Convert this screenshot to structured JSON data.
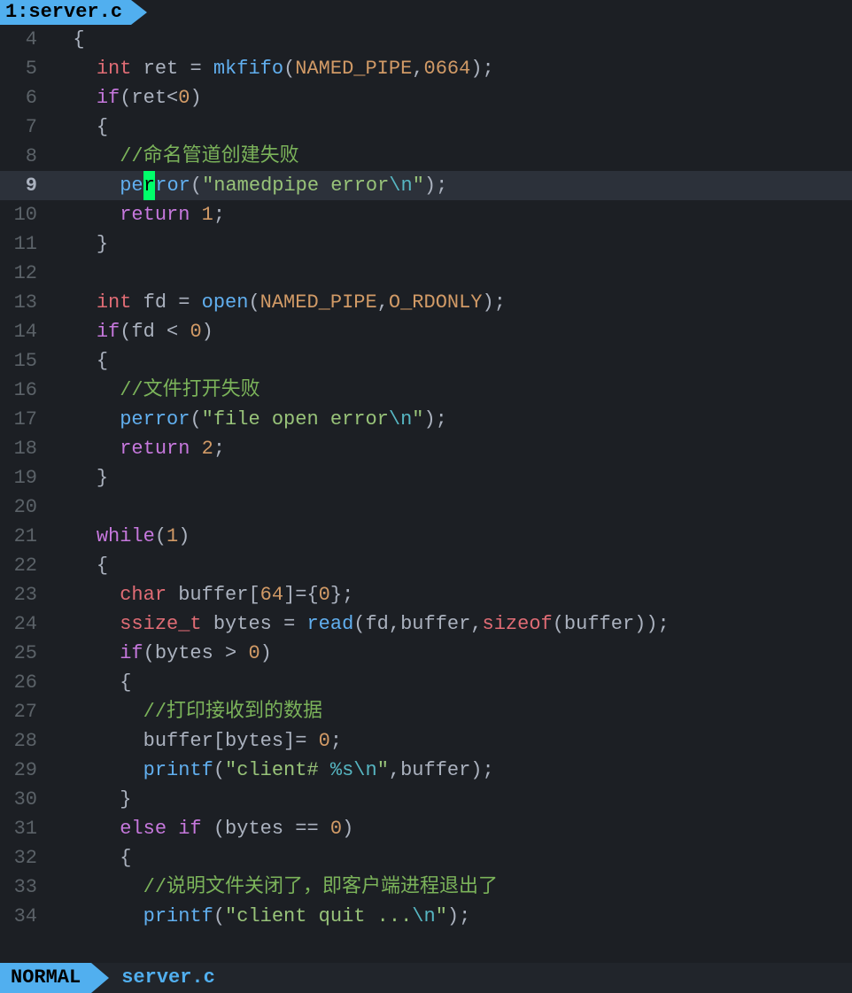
{
  "tab": {
    "index": "1",
    "filename": "server.c"
  },
  "status": {
    "mode": "NORMAL",
    "filename": "server.c"
  },
  "cursor": {
    "line": 9,
    "char": "r"
  },
  "lines": [
    {
      "num": 4,
      "indent": 1,
      "tokens": [
        {
          "cls": "brace",
          "t": "{"
        }
      ]
    },
    {
      "num": 5,
      "indent": 2,
      "tokens": [
        {
          "cls": "kw-type",
          "t": "int"
        },
        {
          "cls": "punct",
          "t": " ret "
        },
        {
          "cls": "op",
          "t": "="
        },
        {
          "cls": "punct",
          "t": " "
        },
        {
          "cls": "fn",
          "t": "mkfifo"
        },
        {
          "cls": "punct",
          "t": "("
        },
        {
          "cls": "const",
          "t": "NAMED_PIPE"
        },
        {
          "cls": "punct",
          "t": ","
        },
        {
          "cls": "num",
          "t": "0664"
        },
        {
          "cls": "punct",
          "t": ");"
        }
      ]
    },
    {
      "num": 6,
      "indent": 2,
      "tokens": [
        {
          "cls": "kw-ctrl",
          "t": "if"
        },
        {
          "cls": "punct",
          "t": "(ret"
        },
        {
          "cls": "op",
          "t": "<"
        },
        {
          "cls": "num",
          "t": "0"
        },
        {
          "cls": "punct",
          "t": ")"
        }
      ]
    },
    {
      "num": 7,
      "indent": 2,
      "tokens": [
        {
          "cls": "brace",
          "t": "{"
        }
      ]
    },
    {
      "num": 8,
      "indent": 3,
      "tokens": [
        {
          "cls": "comment",
          "t": "//命名管道创建失败"
        }
      ]
    },
    {
      "num": 9,
      "indent": 3,
      "current": true,
      "tokens": [
        {
          "cls": "fn",
          "t": "pe"
        },
        {
          "cls": "cursor",
          "t": "r"
        },
        {
          "cls": "fn",
          "t": "ror"
        },
        {
          "cls": "punct",
          "t": "("
        },
        {
          "cls": "str",
          "t": "\"namedpipe error"
        },
        {
          "cls": "esc",
          "t": "\\n"
        },
        {
          "cls": "str",
          "t": "\""
        },
        {
          "cls": "punct",
          "t": ");"
        }
      ]
    },
    {
      "num": 10,
      "indent": 3,
      "tokens": [
        {
          "cls": "kw-ctrl",
          "t": "return"
        },
        {
          "cls": "punct",
          "t": " "
        },
        {
          "cls": "num",
          "t": "1"
        },
        {
          "cls": "punct",
          "t": ";"
        }
      ]
    },
    {
      "num": 11,
      "indent": 2,
      "tokens": [
        {
          "cls": "brace",
          "t": "}"
        }
      ]
    },
    {
      "num": 12,
      "indent": 0,
      "tokens": []
    },
    {
      "num": 13,
      "indent": 2,
      "tokens": [
        {
          "cls": "kw-type",
          "t": "int"
        },
        {
          "cls": "punct",
          "t": " fd "
        },
        {
          "cls": "op",
          "t": "="
        },
        {
          "cls": "punct",
          "t": " "
        },
        {
          "cls": "fn",
          "t": "open"
        },
        {
          "cls": "punct",
          "t": "("
        },
        {
          "cls": "const",
          "t": "NAMED_PIPE"
        },
        {
          "cls": "punct",
          "t": ","
        },
        {
          "cls": "const",
          "t": "O_RDONLY"
        },
        {
          "cls": "punct",
          "t": ");"
        }
      ]
    },
    {
      "num": 14,
      "indent": 2,
      "tokens": [
        {
          "cls": "kw-ctrl",
          "t": "if"
        },
        {
          "cls": "punct",
          "t": "(fd "
        },
        {
          "cls": "op",
          "t": "<"
        },
        {
          "cls": "punct",
          "t": " "
        },
        {
          "cls": "num",
          "t": "0"
        },
        {
          "cls": "punct",
          "t": ")"
        }
      ]
    },
    {
      "num": 15,
      "indent": 2,
      "tokens": [
        {
          "cls": "brace",
          "t": "{"
        }
      ]
    },
    {
      "num": 16,
      "indent": 3,
      "tokens": [
        {
          "cls": "comment",
          "t": "//文件打开失败"
        }
      ]
    },
    {
      "num": 17,
      "indent": 3,
      "tokens": [
        {
          "cls": "fn",
          "t": "perror"
        },
        {
          "cls": "punct",
          "t": "("
        },
        {
          "cls": "str",
          "t": "\"file open error"
        },
        {
          "cls": "esc",
          "t": "\\n"
        },
        {
          "cls": "str",
          "t": "\""
        },
        {
          "cls": "punct",
          "t": ");"
        }
      ]
    },
    {
      "num": 18,
      "indent": 3,
      "tokens": [
        {
          "cls": "kw-ctrl",
          "t": "return"
        },
        {
          "cls": "punct",
          "t": " "
        },
        {
          "cls": "num",
          "t": "2"
        },
        {
          "cls": "punct",
          "t": ";"
        }
      ]
    },
    {
      "num": 19,
      "indent": 2,
      "tokens": [
        {
          "cls": "brace",
          "t": "}"
        }
      ]
    },
    {
      "num": 20,
      "indent": 0,
      "tokens": []
    },
    {
      "num": 21,
      "indent": 2,
      "tokens": [
        {
          "cls": "kw-ctrl",
          "t": "while"
        },
        {
          "cls": "punct",
          "t": "("
        },
        {
          "cls": "num",
          "t": "1"
        },
        {
          "cls": "punct",
          "t": ")"
        }
      ]
    },
    {
      "num": 22,
      "indent": 2,
      "tokens": [
        {
          "cls": "brace",
          "t": "{"
        }
      ]
    },
    {
      "num": 23,
      "indent": 3,
      "tokens": [
        {
          "cls": "kw-type",
          "t": "char"
        },
        {
          "cls": "punct",
          "t": " buffer["
        },
        {
          "cls": "num",
          "t": "64"
        },
        {
          "cls": "punct",
          "t": "]={"
        },
        {
          "cls": "num",
          "t": "0"
        },
        {
          "cls": "punct",
          "t": "};"
        }
      ]
    },
    {
      "num": 24,
      "indent": 3,
      "tokens": [
        {
          "cls": "kw-type",
          "t": "ssize_t"
        },
        {
          "cls": "punct",
          "t": " bytes "
        },
        {
          "cls": "op",
          "t": "="
        },
        {
          "cls": "punct",
          "t": " "
        },
        {
          "cls": "fn",
          "t": "read"
        },
        {
          "cls": "punct",
          "t": "(fd,buffer,"
        },
        {
          "cls": "kw-type",
          "t": "sizeof"
        },
        {
          "cls": "punct",
          "t": "(buffer));"
        }
      ]
    },
    {
      "num": 25,
      "indent": 3,
      "tokens": [
        {
          "cls": "kw-ctrl",
          "t": "if"
        },
        {
          "cls": "punct",
          "t": "(bytes "
        },
        {
          "cls": "op",
          "t": ">"
        },
        {
          "cls": "punct",
          "t": " "
        },
        {
          "cls": "num",
          "t": "0"
        },
        {
          "cls": "punct",
          "t": ")"
        }
      ]
    },
    {
      "num": 26,
      "indent": 3,
      "tokens": [
        {
          "cls": "brace",
          "t": "{"
        }
      ]
    },
    {
      "num": 27,
      "indent": 4,
      "tokens": [
        {
          "cls": "comment",
          "t": "//打印接收到的数据"
        }
      ]
    },
    {
      "num": 28,
      "indent": 4,
      "tokens": [
        {
          "cls": "punct",
          "t": "buffer[bytes]"
        },
        {
          "cls": "op",
          "t": "="
        },
        {
          "cls": "punct",
          "t": " "
        },
        {
          "cls": "num",
          "t": "0"
        },
        {
          "cls": "punct",
          "t": ";"
        }
      ]
    },
    {
      "num": 29,
      "indent": 4,
      "tokens": [
        {
          "cls": "fn",
          "t": "printf"
        },
        {
          "cls": "punct",
          "t": "("
        },
        {
          "cls": "str",
          "t": "\"client# "
        },
        {
          "cls": "esc",
          "t": "%s\\n"
        },
        {
          "cls": "str",
          "t": "\""
        },
        {
          "cls": "punct",
          "t": ",buffer);"
        }
      ]
    },
    {
      "num": 30,
      "indent": 3,
      "tokens": [
        {
          "cls": "brace",
          "t": "}"
        }
      ]
    },
    {
      "num": 31,
      "indent": 3,
      "tokens": [
        {
          "cls": "kw-ctrl",
          "t": "else"
        },
        {
          "cls": "punct",
          "t": " "
        },
        {
          "cls": "kw-ctrl",
          "t": "if"
        },
        {
          "cls": "punct",
          "t": " (bytes "
        },
        {
          "cls": "op",
          "t": "=="
        },
        {
          "cls": "punct",
          "t": " "
        },
        {
          "cls": "num",
          "t": "0"
        },
        {
          "cls": "punct",
          "t": ")"
        }
      ]
    },
    {
      "num": 32,
      "indent": 3,
      "tokens": [
        {
          "cls": "brace",
          "t": "{"
        }
      ]
    },
    {
      "num": 33,
      "indent": 4,
      "tokens": [
        {
          "cls": "comment",
          "t": "//说明文件关闭了，即客户端进程退出了"
        }
      ]
    },
    {
      "num": 34,
      "indent": 4,
      "tokens": [
        {
          "cls": "fn",
          "t": "printf"
        },
        {
          "cls": "punct",
          "t": "("
        },
        {
          "cls": "str",
          "t": "\"client quit ..."
        },
        {
          "cls": "esc",
          "t": "\\n"
        },
        {
          "cls": "str",
          "t": "\""
        },
        {
          "cls": "punct",
          "t": ");"
        }
      ]
    }
  ]
}
